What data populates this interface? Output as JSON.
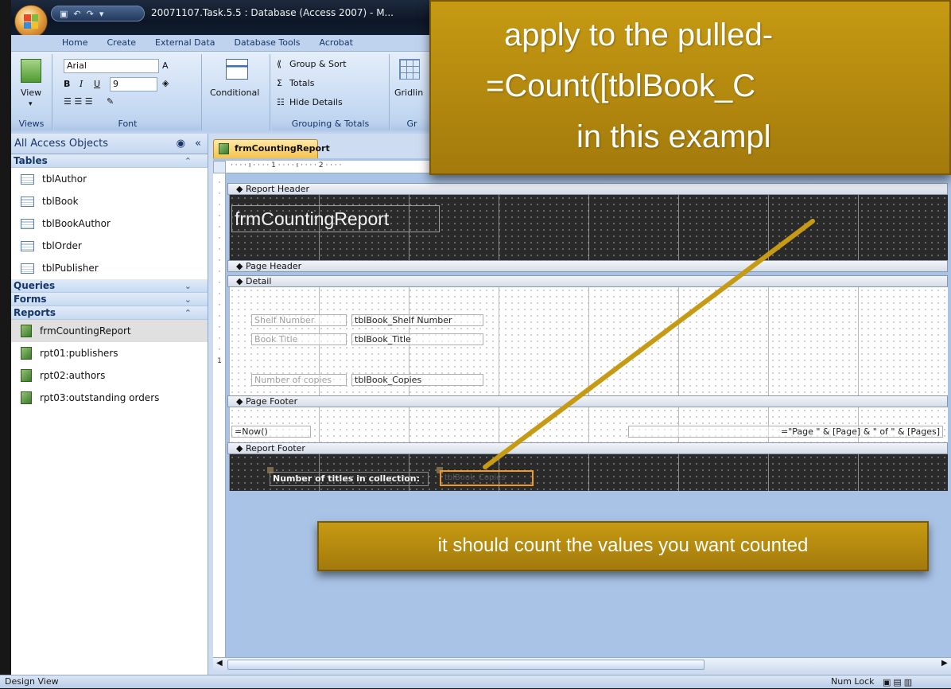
{
  "window": {
    "title": "20071107.Task.5.5 : Database (Access 2007) - M..."
  },
  "ribbon": {
    "tabs": [
      "Home",
      "Create",
      "External Data",
      "Database Tools",
      "Acrobat"
    ],
    "views": {
      "button": "View",
      "label": "Views"
    },
    "font": {
      "family": "Arial",
      "size": "9",
      "label": "Font",
      "bold": "B",
      "italic": "I",
      "underline": "U",
      "font_color": "A"
    },
    "conditional": "Conditional",
    "grouping": {
      "group_sort": "Group & Sort",
      "totals": "Totals",
      "hide_details": "Hide Details",
      "label": "Grouping & Totals"
    },
    "gridlines": {
      "button": "Gridlin",
      "label": "Gr"
    }
  },
  "nav": {
    "header": "All Access Objects",
    "groups": {
      "tables": "Tables",
      "queries": "Queries",
      "forms": "Forms",
      "reports": "Reports"
    },
    "tables": [
      "tblAuthor",
      "tblBook",
      "tblBookAuthor",
      "tblOrder",
      "tblPublisher"
    ],
    "reports": [
      "frmCountingReport",
      "rpt01:publishers",
      "rpt02:authors",
      "rpt03:outstanding orders"
    ]
  },
  "document": {
    "tab": "frmCountingReport",
    "sections": {
      "report_header": "Report Header",
      "page_header": "Page Header",
      "detail": "Detail",
      "page_footer": "Page Footer",
      "report_footer": "Report Footer"
    },
    "report_title": "frmCountingReport",
    "detail_fields": [
      {
        "label": "Shelf Number",
        "control": "tblBook_Shelf Number"
      },
      {
        "label": "Book Title",
        "control": "tblBook_Title"
      },
      {
        "label": "Number of copies",
        "control": "tblBook_Copies"
      }
    ],
    "page_footer_left": "=Now()",
    "page_footer_right": "=\"Page \" & [Page] & \" of \" & [Pages]",
    "report_footer_label": "Number of titles in collection:",
    "report_footer_control": "tblBook_Copies"
  },
  "callouts": {
    "big_lines": [
      "apply to the pulled-",
      "=Count([tblBook_C",
      "in this exampl"
    ],
    "small": "it should count the values you want counted"
  },
  "status": {
    "left": "Design View",
    "num_lock": "Num Lock"
  },
  "colors": {
    "callout": "#b58910",
    "ribbon": "#c6daf3",
    "leader_line": "#c69a12"
  }
}
